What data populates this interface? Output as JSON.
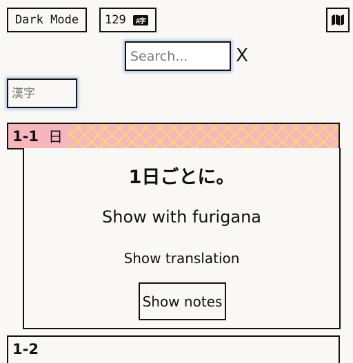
{
  "toolbar": {
    "dark_mode_label": "Dark Mode",
    "count_value": "129",
    "count_badge": "A字",
    "map_icon": "map-icon"
  },
  "search": {
    "placeholder": "Search...",
    "clear_label": "X"
  },
  "kanji_filter": {
    "placeholder": "漢字"
  },
  "sections": [
    {
      "id": "1-1",
      "kanji": "日",
      "sentence": "1日ごとに。",
      "furigana_label": "Show with furigana",
      "translation_label": "Show translation",
      "notes_label": "Show notes"
    },
    {
      "id": "1-2"
    }
  ],
  "colors": {
    "background": "#f9f8f4",
    "header_pink": "#f7b6bd",
    "header_pattern_yellow": "#f1dc6c",
    "focus_glow": "#a9c4ea"
  }
}
